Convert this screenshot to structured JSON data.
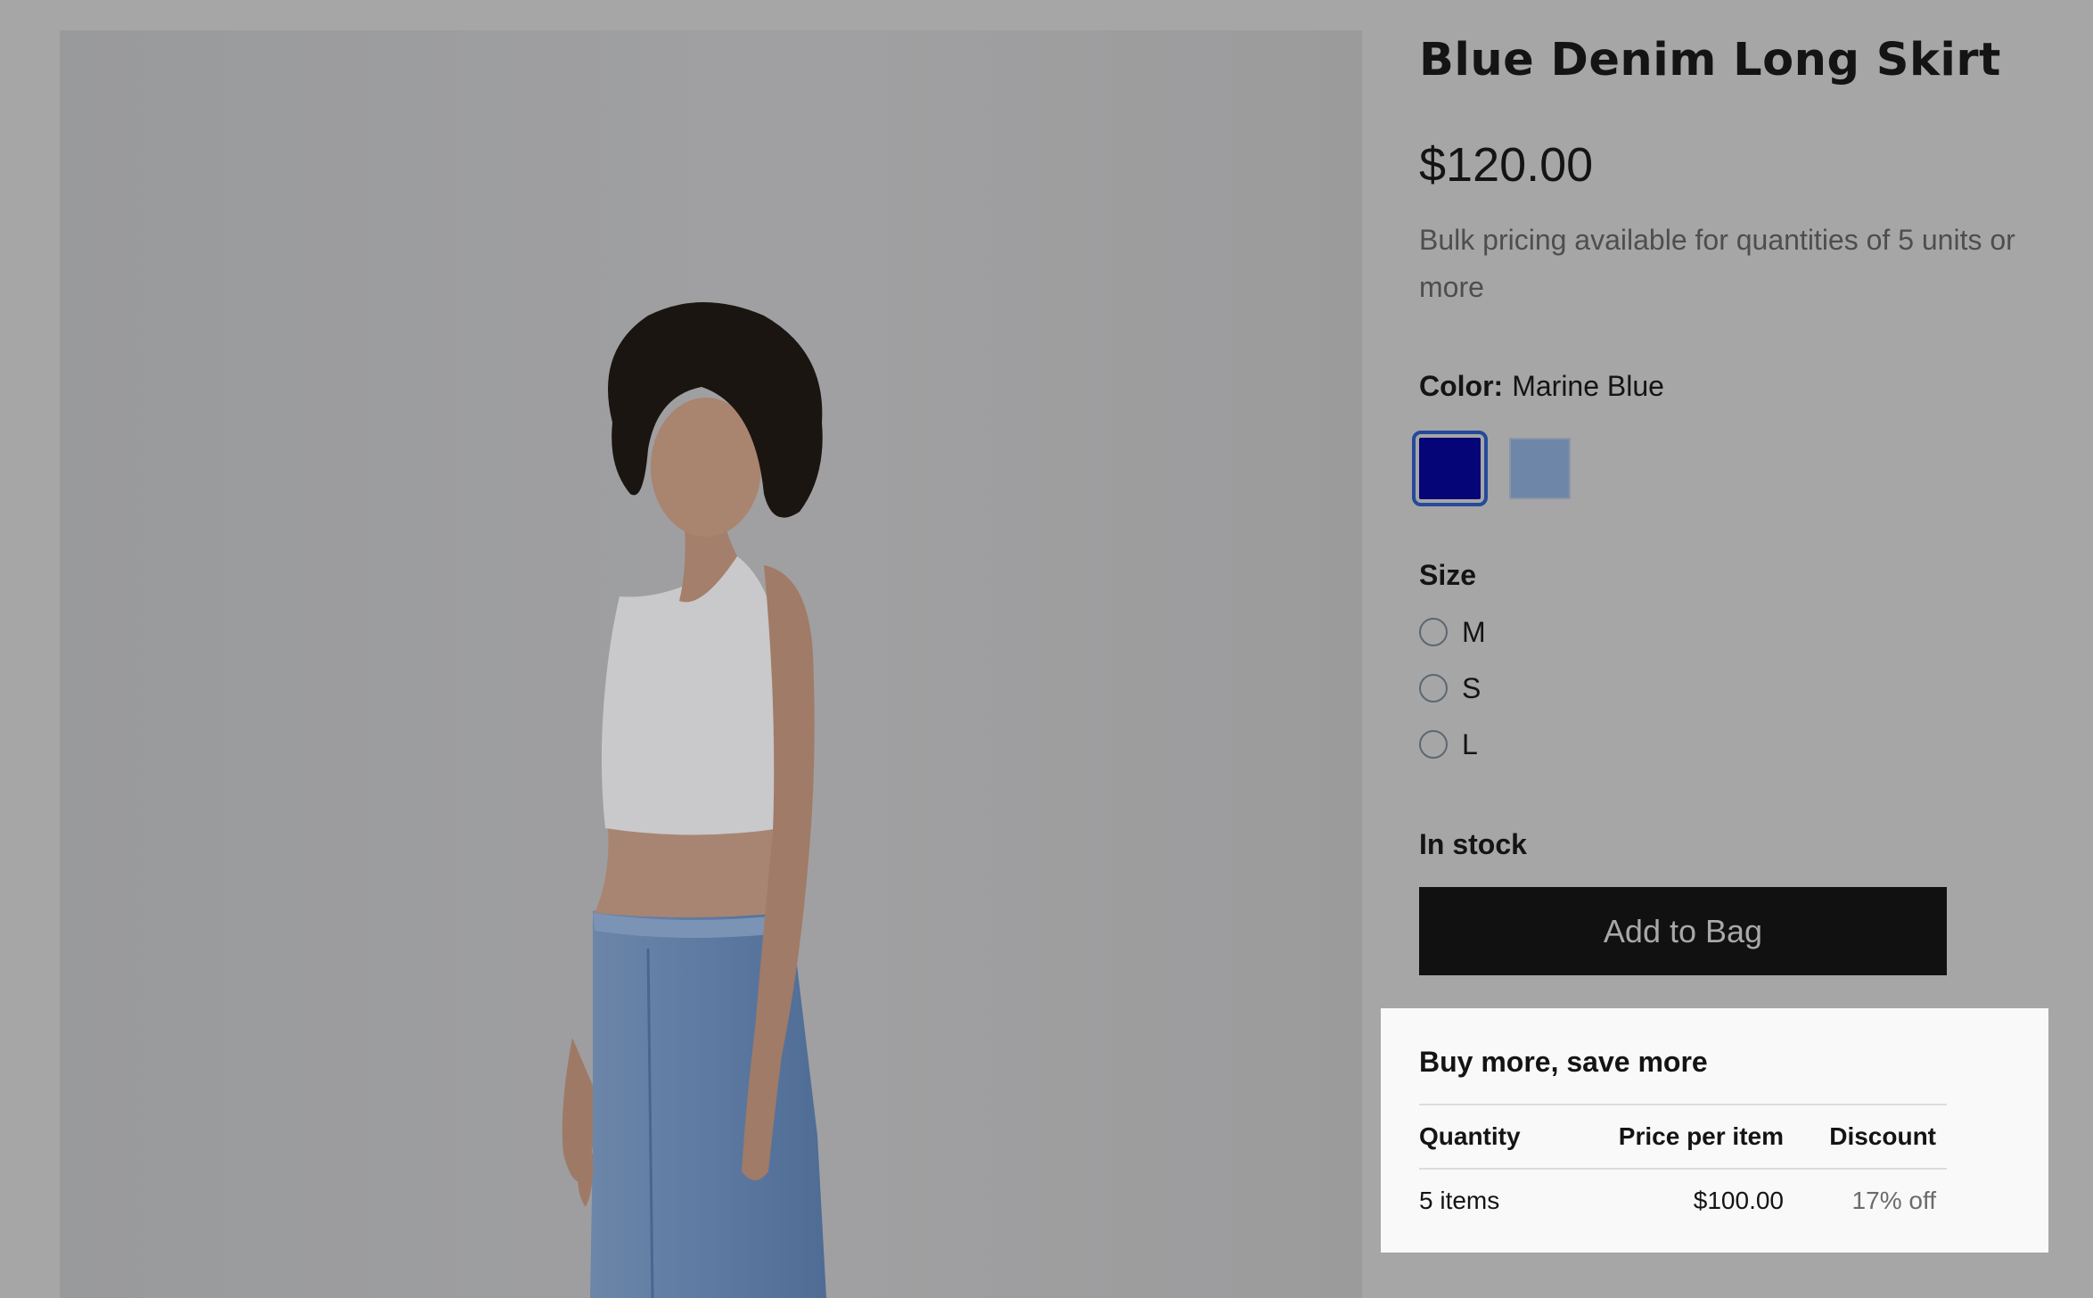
{
  "product": {
    "title": "Blue Denim Long Skirt",
    "price": "$120.00",
    "bulk_note": "Bulk pricing available for quantities of 5 units or more",
    "image_alt": "Model wearing a white tank top and blue denim long skirt"
  },
  "color": {
    "label": "Color:",
    "selected": "Marine Blue",
    "swatches": [
      {
        "name": "Marine Blue",
        "hex": "#050577",
        "selected": true
      },
      {
        "name": "Light Blue",
        "hex": "#6e86a8",
        "selected": false
      }
    ]
  },
  "size": {
    "label": "Size",
    "options": [
      "M",
      "S",
      "L"
    ]
  },
  "stock": {
    "status": "In stock"
  },
  "actions": {
    "add_to_bag": "Add to Bag"
  },
  "bulk_pricing": {
    "title": "Buy more, save more",
    "columns": [
      "Quantity",
      "Price per item",
      "Discount"
    ],
    "rows": [
      {
        "quantity": "5 items",
        "price": "$100.00",
        "discount": "17% off"
      }
    ]
  },
  "colors": {
    "overlay_background": "#a6a6a6",
    "button_background": "#111111",
    "panel_background": "#f9f9f9"
  }
}
